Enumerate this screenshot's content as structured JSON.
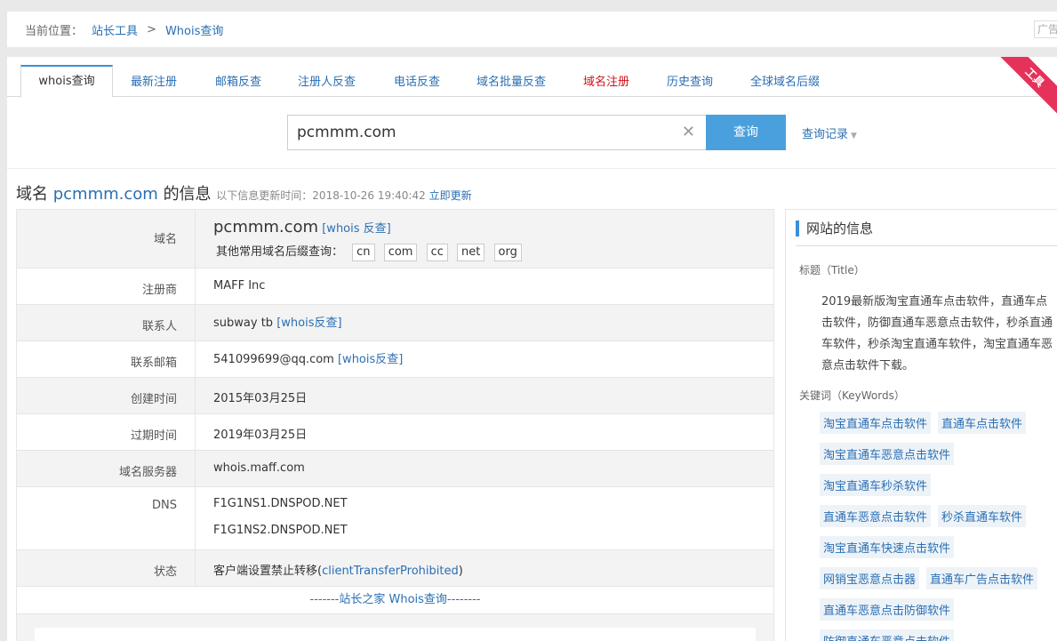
{
  "breadcrumb": {
    "prefix": "当前位置：",
    "level1": "站长工具",
    "separator": ">",
    "level2": "Whois查询",
    "ad": "广告"
  },
  "tabs": [
    {
      "label": "whois查询",
      "active": true
    },
    {
      "label": "最新注册"
    },
    {
      "label": "邮箱反查"
    },
    {
      "label": "注册人反查"
    },
    {
      "label": "电话反查"
    },
    {
      "label": "域名批量反查"
    },
    {
      "label": "域名注册",
      "highlight": "#d0121b"
    },
    {
      "label": "历史查询"
    },
    {
      "label": "全球域名后缀"
    }
  ],
  "ribbon": "工具",
  "search": {
    "value": "pcmmm.com",
    "button": "查询",
    "history": "查询记录"
  },
  "heading": {
    "prefix": "域名",
    "domain": "pcmmm.com",
    "suffix": "的信息",
    "update_text": "以下信息更新时间：2018-10-26 19:40:42",
    "update_link": "立即更新"
  },
  "table": {
    "domain": {
      "label": "域名",
      "value": "pcmmm.com",
      "link": "[whois 反查]",
      "suffix_label": "其他常用域名后缀查询：",
      "suffixes": [
        "cn",
        "com",
        "cc",
        "net",
        "org"
      ]
    },
    "registrar": {
      "label": "注册商",
      "value": "MAFF Inc"
    },
    "contact": {
      "label": "联系人",
      "value": "subway tb",
      "link": "[whois反查]"
    },
    "email": {
      "label": "联系邮箱",
      "value": "541099699@qq.com",
      "link": "[whois反查]"
    },
    "created": {
      "label": "创建时间",
      "value": "2015年03月25日"
    },
    "expires": {
      "label": "过期时间",
      "value": "2019年03月25日"
    },
    "server": {
      "label": "域名服务器",
      "value": "whois.maff.com"
    },
    "dns": {
      "label": "DNS",
      "values": [
        "F1G1NS1.DNSPOD.NET",
        "F1G1NS2.DNSPOD.NET"
      ]
    },
    "status": {
      "label": "状态",
      "value": "客户端设置禁止转移(",
      "link": "clientTransferProhibited",
      "close": ")"
    },
    "footer": "-------站长之家 Whois查询--------"
  },
  "side": {
    "title": "网站的信息",
    "title_label": "标题（Title）",
    "title_text": "2019最新版淘宝直通车点击软件，直通车点击软件，防御直通车恶意点击软件，秒杀直通车软件，秒杀淘宝直通车软件，淘宝直通车恶意点击软件下载。",
    "kw_label": "关键词（KeyWords）",
    "keywords": [
      "淘宝直通车点击软件",
      "直通车点击软件",
      "淘宝直通车恶意点击软件",
      "淘宝直通车秒杀软件",
      "直通车恶意点击软件",
      "秒杀直通车软件",
      "淘宝直通车快速点击软件",
      "网销宝恶意点击器",
      "直通车广告点击软件",
      "直通车恶意点击防御软件",
      "防御直通车恶意点击软件"
    ]
  },
  "colors": {
    "accent": "#3b8fd8",
    "link": "#2a6fb3",
    "button": "#4aa0dd",
    "ribbon": "#e5325b"
  }
}
